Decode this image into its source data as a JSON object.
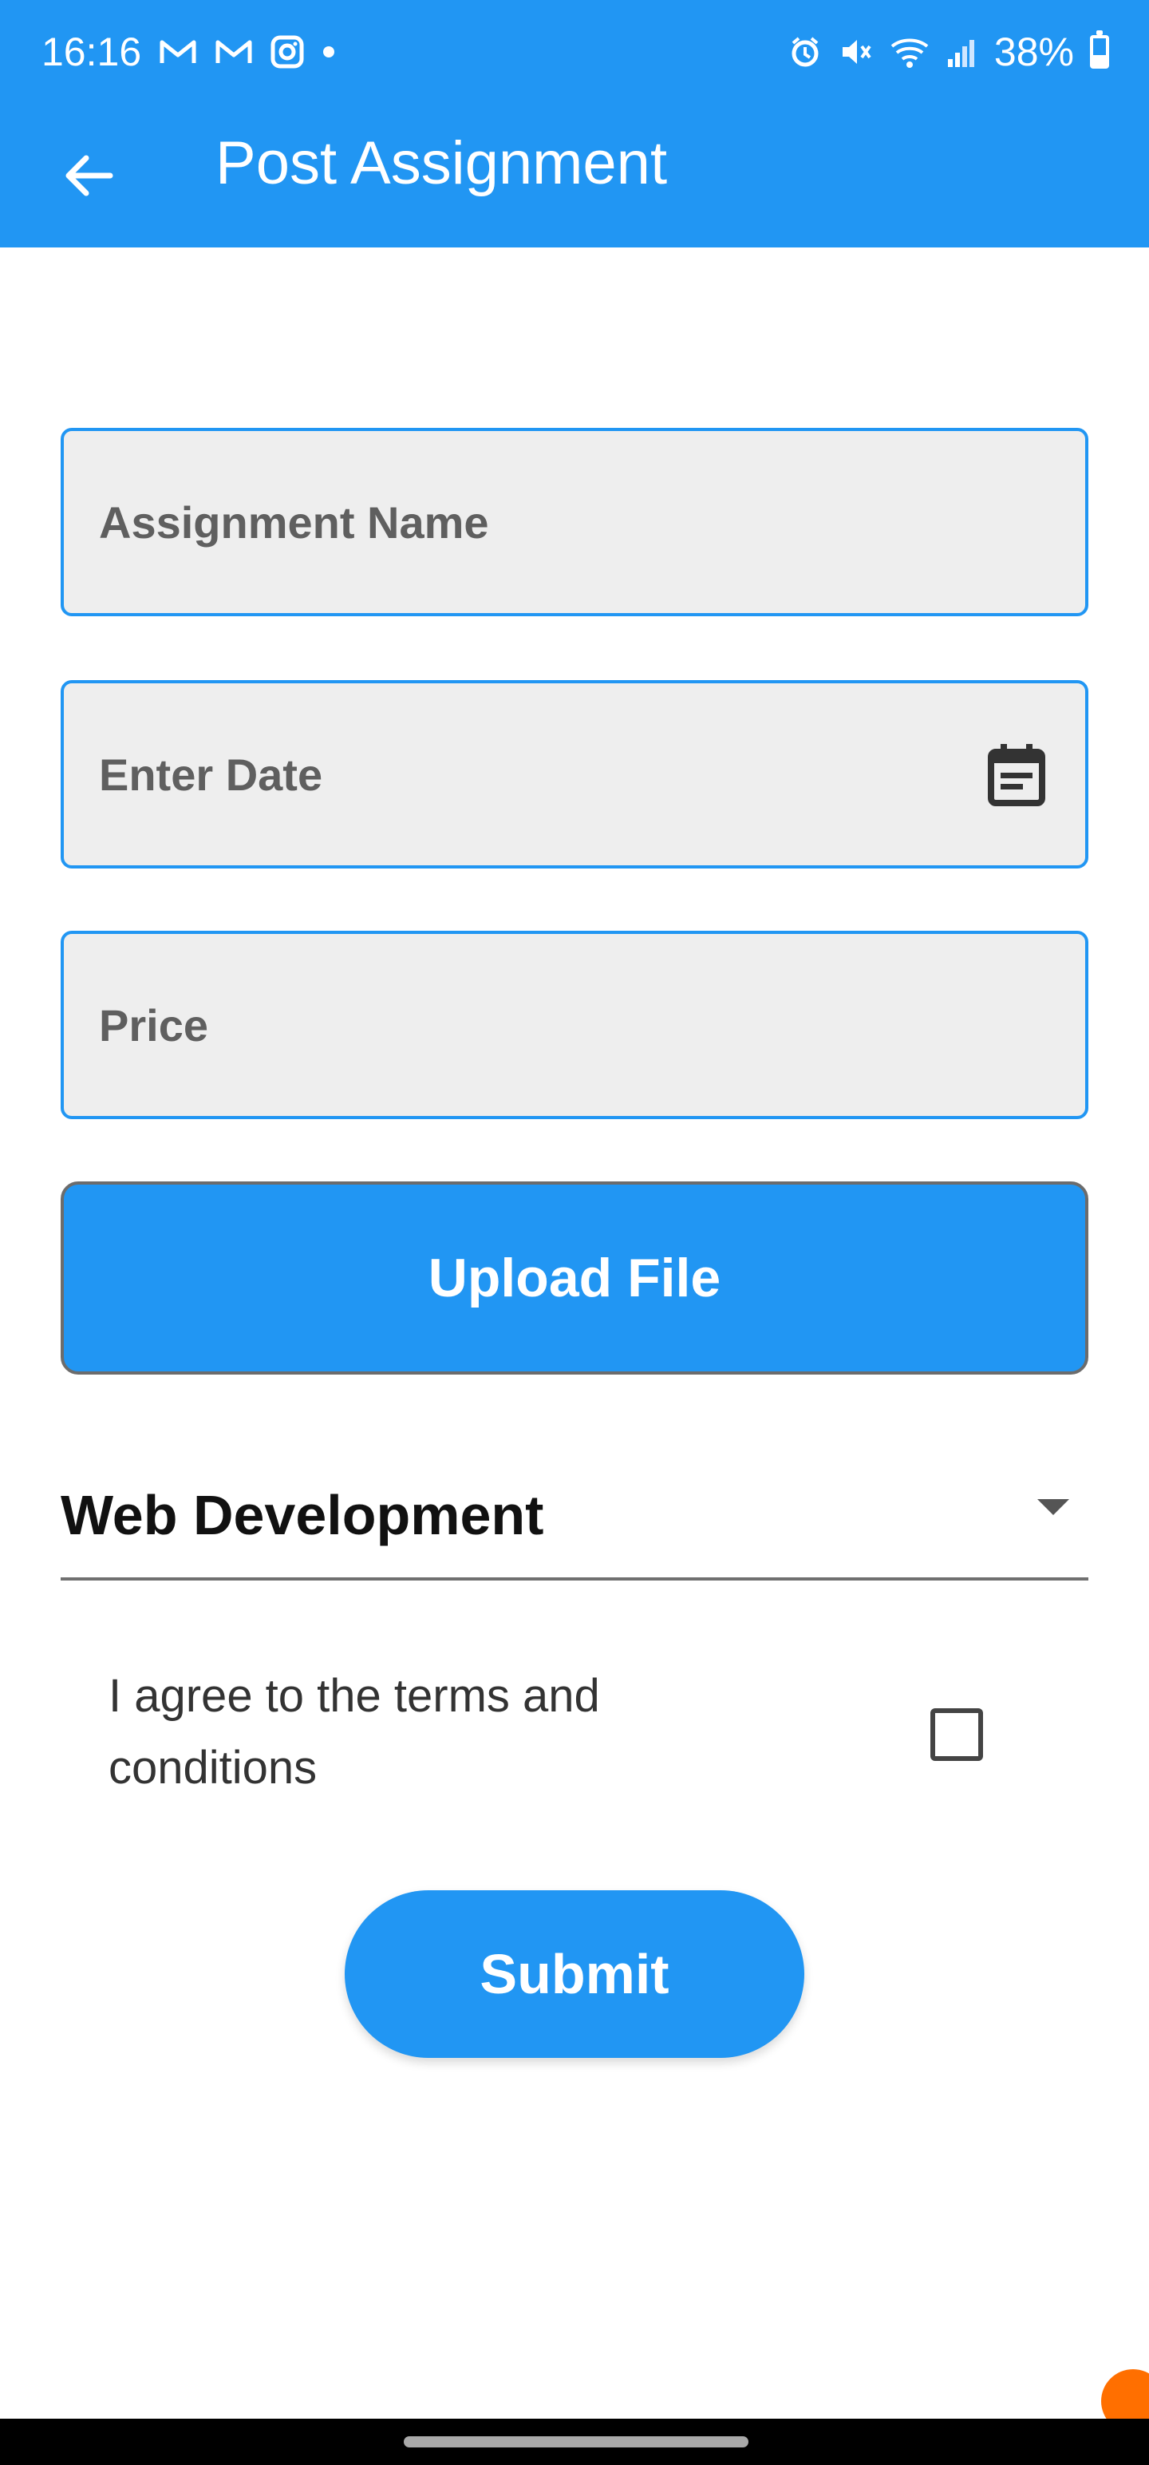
{
  "status_bar": {
    "time": "16:16",
    "battery": "38%",
    "icons_left": [
      "gmail-icon",
      "gmail-icon",
      "instagram-icon",
      "dot-icon"
    ],
    "icons_right": [
      "alarm-icon",
      "mute-icon",
      "wifi-icon",
      "signal-icon",
      "battery-icon"
    ]
  },
  "app_bar": {
    "title": "Post Assignment",
    "back_icon": "arrow-back-icon",
    "color": "#2196F3"
  },
  "form": {
    "assignment_name": {
      "value": "",
      "placeholder": "Assignment Name"
    },
    "date": {
      "value": "",
      "placeholder": "Enter Date",
      "icon": "calendar-icon"
    },
    "price": {
      "value": "",
      "placeholder": "Price"
    },
    "upload_label": "Upload File",
    "category": {
      "selected": "Web Development"
    },
    "terms_text": "I agree to the terms and conditions",
    "terms_checked": false,
    "submit_label": "Submit"
  }
}
